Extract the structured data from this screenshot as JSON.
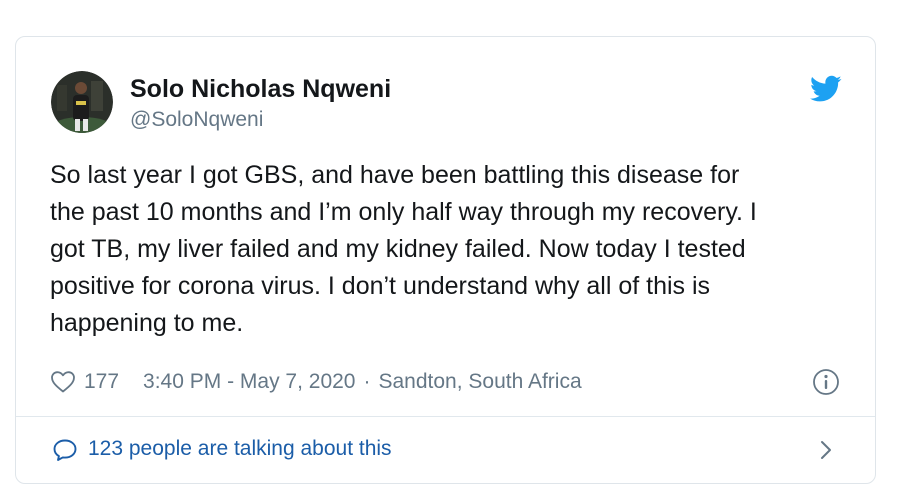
{
  "tweet": {
    "author": {
      "display_name": "Solo Nicholas Nqweni",
      "handle": "@SoloNqweni"
    },
    "text": "So last year I got GBS, and have been battling this disease for\nthe past 10 months and I’m only half way through my recovery. I\ngot TB, my liver failed and my kidney failed. Now today I tested\npositive for corona virus. I don’t understand why all of this is\nhappening to me.",
    "likes": "177",
    "timestamp": "3:40 PM - May 7, 2020",
    "separator": "·",
    "location": "Sandton, South Africa",
    "talking_text": "123 people are talking about this"
  },
  "icons": {
    "brand": "twitter-bird-icon",
    "like": "heart-icon",
    "info": "info-icon",
    "conversation": "speech-bubble-icon",
    "more": "chevron-right-icon"
  },
  "colors": {
    "twitter_blue": "#1da1f2",
    "link_blue": "#1b5da8",
    "text_primary": "#14171a",
    "text_secondary": "#657786",
    "border": "#dfe5ea"
  }
}
